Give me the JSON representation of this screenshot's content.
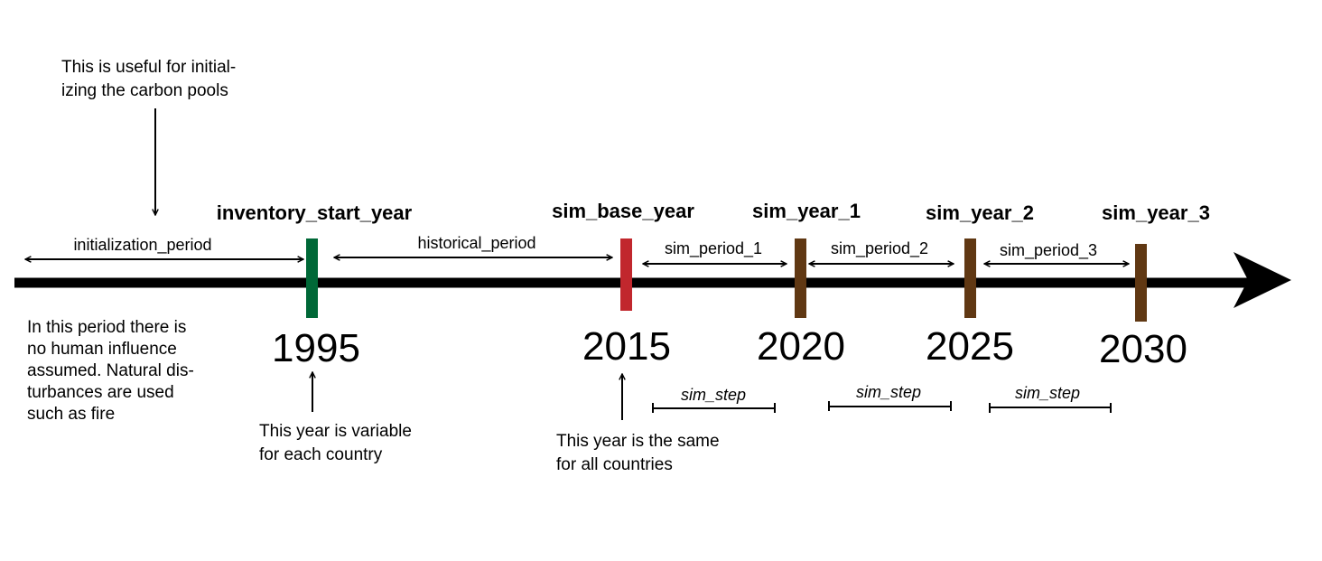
{
  "top_note": {
    "lines": [
      "This is useful for initial-",
      "izing the carbon pools"
    ]
  },
  "milestones": [
    {
      "label": "inventory_start_year",
      "year": "1995",
      "color": "#006837"
    },
    {
      "label": "sim_base_year",
      "year": "2015",
      "color": "#c1272d"
    },
    {
      "label": "sim_year_1",
      "year": "2020",
      "color": "#603813"
    },
    {
      "label": "sim_year_2",
      "year": "2025",
      "color": "#603813"
    },
    {
      "label": "sim_year_3",
      "year": "2030",
      "color": "#603813"
    }
  ],
  "periods": [
    {
      "label": "initialization_period"
    },
    {
      "label": "historical_period"
    },
    {
      "label": "sim_period_1"
    },
    {
      "label": "sim_period_2"
    },
    {
      "label": "sim_period_3"
    }
  ],
  "sim_steps": [
    "sim_step",
    "sim_step",
    "sim_step"
  ],
  "left_note": {
    "lines": [
      "In this period there is",
      "no human influence",
      "assumed. Natural dis-",
      "turbances are used",
      "such as fire"
    ]
  },
  "note_1995": {
    "lines": [
      "This year is variable",
      "for each country"
    ]
  },
  "note_2015": {
    "lines": [
      "This year is the same",
      "for all countries"
    ]
  }
}
